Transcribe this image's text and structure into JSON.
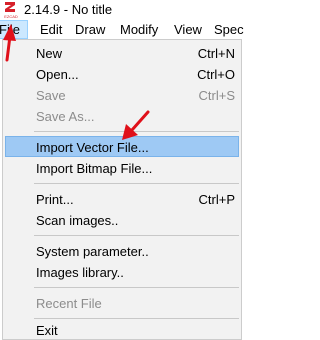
{
  "window": {
    "title": "2.14.9 - No title"
  },
  "menubar": {
    "items": [
      {
        "label": "File"
      },
      {
        "label": "Edit"
      },
      {
        "label": "Draw"
      },
      {
        "label": "Modify"
      },
      {
        "label": "View"
      },
      {
        "label": "Spec"
      }
    ]
  },
  "file_menu": {
    "items": [
      {
        "label": "New",
        "shortcut": "Ctrl+N",
        "enabled": true
      },
      {
        "label": "Open...",
        "shortcut": "Ctrl+O",
        "enabled": true
      },
      {
        "label": "Save",
        "shortcut": "Ctrl+S",
        "enabled": false
      },
      {
        "label": "Save As...",
        "shortcut": "",
        "enabled": false
      },
      {
        "label": "Import Vector File...",
        "shortcut": "",
        "enabled": true,
        "highlighted": true
      },
      {
        "label": "Import Bitmap File...",
        "shortcut": "",
        "enabled": true
      },
      {
        "label": "Print...",
        "shortcut": "Ctrl+P",
        "enabled": true
      },
      {
        "label": "Scan images..",
        "shortcut": "",
        "enabled": true
      },
      {
        "label": "System parameter..",
        "shortcut": "",
        "enabled": true
      },
      {
        "label": "Images library..",
        "shortcut": "",
        "enabled": true
      },
      {
        "label": "Recent File",
        "shortcut": "",
        "enabled": false
      },
      {
        "label": "Exit",
        "shortcut": "",
        "enabled": true
      }
    ]
  },
  "colors": {
    "highlight": "#9ec9f4",
    "active_menu": "#cce8ff",
    "annotation_arrow": "#e0101a",
    "logo": "#d6202a"
  },
  "icons": [
    "app-logo-icon",
    "annotation-arrow"
  ]
}
